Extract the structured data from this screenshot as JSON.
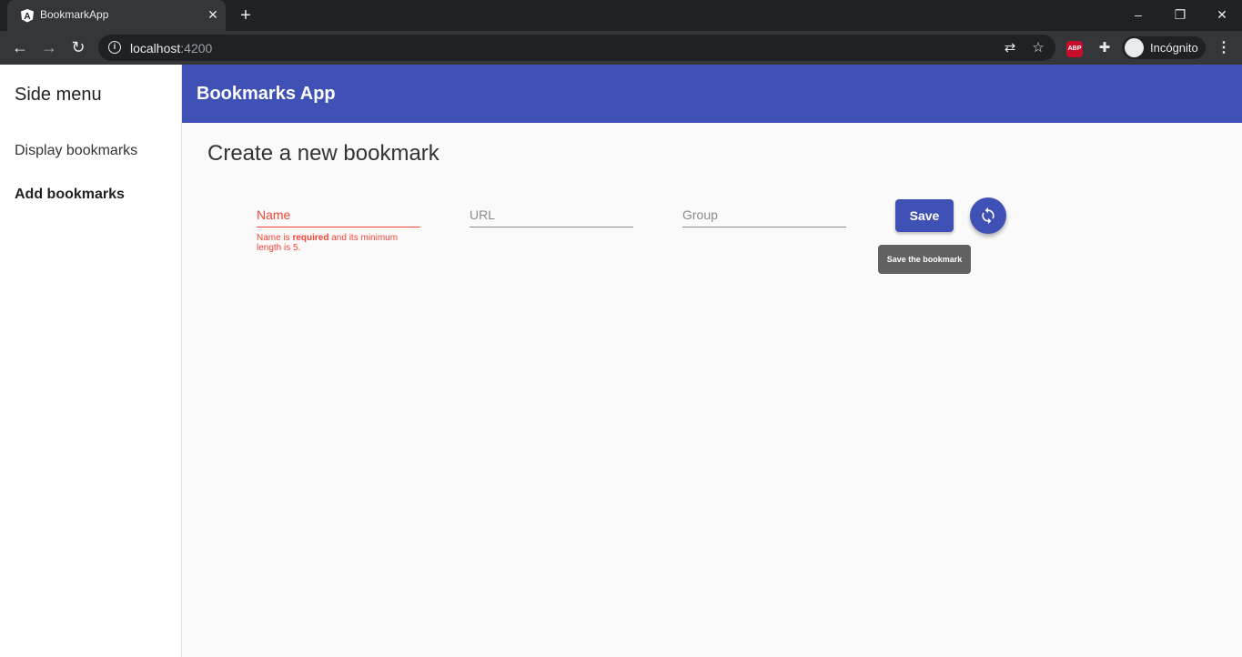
{
  "browser": {
    "tab_title": "BookmarkApp",
    "tab_close": "✕",
    "new_tab": "+",
    "url_host": "localhost",
    "url_port": ":4200",
    "profile_label": "Incógnito",
    "abp_label": "ABP"
  },
  "sidenav": {
    "title": "Side menu",
    "items": [
      {
        "label": "Display bookmarks",
        "active": false
      },
      {
        "label": "Add bookmarks",
        "active": true
      }
    ]
  },
  "appbar": {
    "title": "Bookmarks App",
    "color": "#3f51b5"
  },
  "form": {
    "heading": "Create a new bookmark",
    "fields": {
      "name": {
        "label": "Name",
        "invalid": true
      },
      "url": {
        "label": "URL"
      },
      "group": {
        "label": "Group"
      }
    },
    "error": {
      "prefix": "Name is ",
      "bold": "required",
      "suffix": " and its minimum length is 5."
    },
    "save_label": "Save",
    "tooltip": "Save the bookmark",
    "error_color": "#f44336"
  }
}
